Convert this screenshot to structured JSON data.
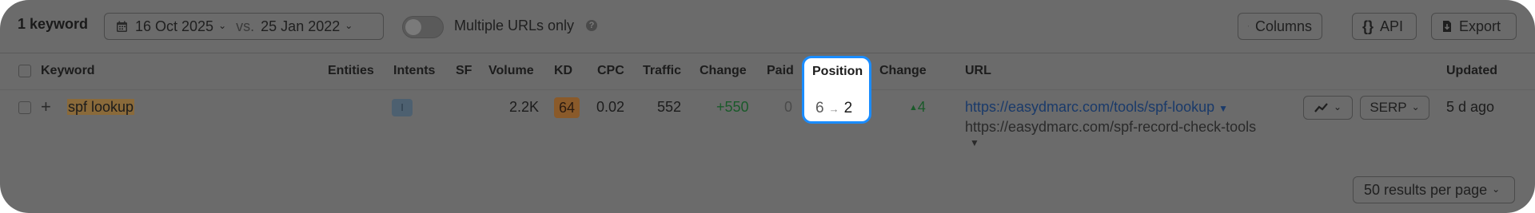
{
  "toolbar": {
    "keyword_count": "1 keyword",
    "date_primary": "16 Oct 2025",
    "vs_label": "vs.",
    "date_compare": "25 Jan 2022",
    "multiple_urls_label": "Multiple URLs only",
    "multiple_urls_enabled": false,
    "columns_label": "Columns",
    "api_label": "API",
    "export_label": "Export"
  },
  "table": {
    "headers": {
      "keyword": "Keyword",
      "entities": "Entities",
      "intents": "Intents",
      "sf": "SF",
      "volume": "Volume",
      "kd": "KD",
      "cpc": "CPC",
      "traffic": "Traffic",
      "change": "Change",
      "paid": "Paid",
      "position": "Position",
      "position_change": "Change",
      "url": "URL",
      "updated": "Updated"
    },
    "rows": [
      {
        "keyword": "spf lookup",
        "intent": "I",
        "volume": "2.2K",
        "kd": "64",
        "cpc": "0.02",
        "traffic": "552",
        "traffic_change": "+550",
        "paid": "0",
        "position_old": "6",
        "position_new": "2",
        "position_change": "4",
        "url_primary": "https://easydmarc.com/tools/spf-lookup",
        "url_secondary": "https://easydmarc.com/spf-record-check-tools",
        "serp_label": "SERP",
        "updated": "5 d ago"
      }
    ]
  },
  "footer": {
    "per_page_label": "50 results per page"
  },
  "colors": {
    "overlay": "#6b6b6b",
    "highlight_border": "#1a8cff",
    "positive": "#1a5a2a"
  }
}
